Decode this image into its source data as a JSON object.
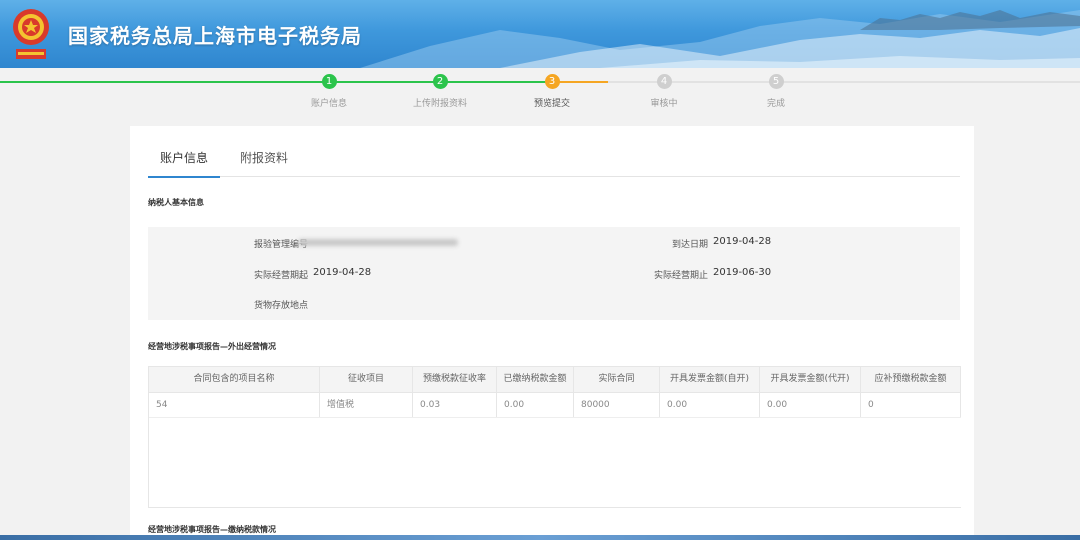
{
  "header": {
    "title": "国家税务总局上海市电子税务局"
  },
  "steps": [
    {
      "num": "1",
      "label": "账户信息",
      "state": "done"
    },
    {
      "num": "2",
      "label": "上传附报资料",
      "state": "done"
    },
    {
      "num": "3",
      "label": "预览提交",
      "state": "current"
    },
    {
      "num": "4",
      "label": "审核中",
      "state": "todo"
    },
    {
      "num": "5",
      "label": "完成",
      "state": "todo"
    }
  ],
  "tabs": [
    {
      "label": "账户信息",
      "active": true
    },
    {
      "label": "附报资料",
      "active": false
    }
  ],
  "sections": {
    "basic": "纳税人基本信息",
    "outside": "经营地涉税事项报告—外出经营情况",
    "prepaid": "经营地涉税事项报告—缴纳税款情况"
  },
  "info": {
    "report_no_label": "报验管理编号",
    "arrival_label": "到达日期",
    "arrival_value": "2019-04-28",
    "start_label": "实际经营期起",
    "start_value": "2019-04-28",
    "end_label": "实际经营期止",
    "end_value": "2019-06-30",
    "location_label": "货物存放地点"
  },
  "table": {
    "headers": [
      "合同包含的项目名称",
      "征收项目",
      "预缴税款征收率",
      "已缴纳税款金额",
      "实际合同",
      "开具发票金额(自开)",
      "开具发票金额(代开)",
      "应补预缴税款金额"
    ],
    "rows": [
      [
        "54",
        "增值税",
        "0.03",
        "0.00",
        "80000",
        "0.00",
        "0.00",
        "0"
      ]
    ]
  },
  "colors": {
    "done": "#2cc44c",
    "current": "#f5a623",
    "todo": "#cfcfcf",
    "header": "#3f98dc"
  }
}
